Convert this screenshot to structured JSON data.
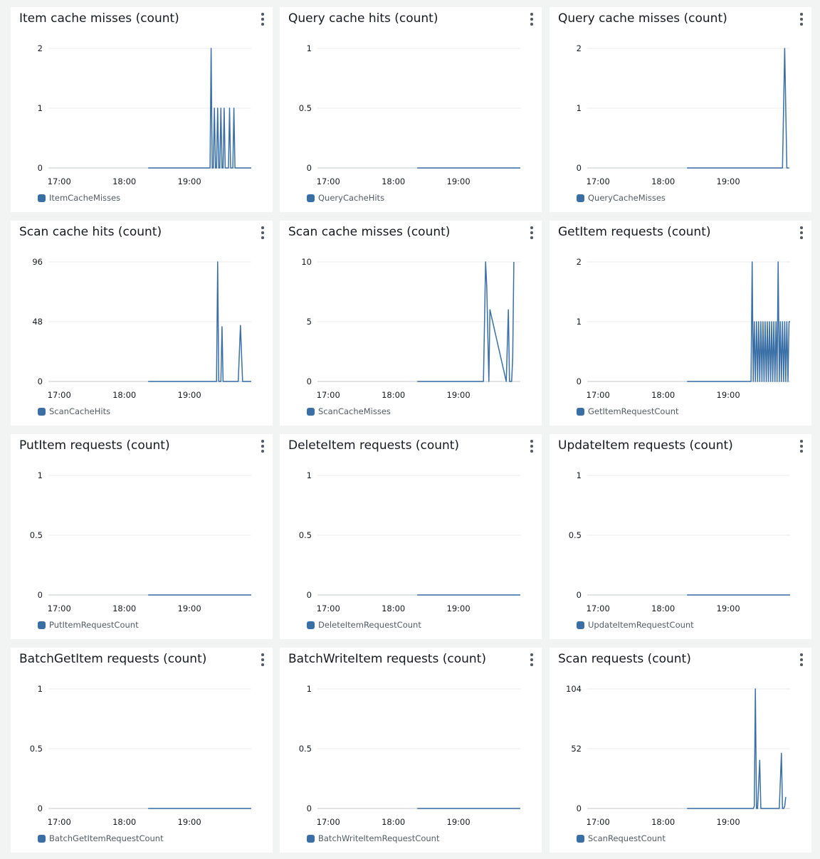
{
  "colors": {
    "series": "#3a6fa6",
    "grid": "#eaeded",
    "axis": "#d5dbdb"
  },
  "x_ticks": [
    "17:00",
    "18:00",
    "19:00"
  ],
  "chart_data": [
    {
      "type": "line",
      "title": "Item cache misses (count)",
      "legend": "ItemCacheMisses",
      "yticks": [
        "0",
        "1",
        "2"
      ],
      "ylim": [
        0,
        2
      ],
      "xlim": [
        "16:50",
        "19:57"
      ],
      "data_start": "18:22",
      "series": [
        {
          "name": "ItemCacheMisses",
          "x": [
            "18:22",
            "19:19",
            "19:20",
            "19:21",
            "19:22",
            "19:23",
            "19:24",
            "19:25",
            "19:26",
            "19:27",
            "19:28",
            "19:29",
            "19:30",
            "19:31",
            "19:32",
            "19:33",
            "19:34",
            "19:35",
            "19:36",
            "19:37",
            "19:38",
            "19:39",
            "19:40",
            "19:41",
            "19:42",
            "19:43",
            "19:57"
          ],
          "y": [
            0,
            0,
            2,
            0,
            0,
            1,
            0,
            0,
            1,
            0,
            0,
            1,
            0,
            0,
            1,
            0,
            0,
            0,
            0,
            1,
            0,
            0,
            0,
            1,
            0,
            0,
            0
          ]
        }
      ]
    },
    {
      "type": "line",
      "title": "Query cache hits (count)",
      "legend": "QueryCacheHits",
      "yticks": [
        "0",
        "0.5",
        "1"
      ],
      "ylim": [
        0,
        1
      ],
      "xlim": [
        "16:50",
        "19:57"
      ],
      "data_start": "18:22",
      "series": [
        {
          "name": "QueryCacheHits",
          "x": [
            "18:22",
            "19:57"
          ],
          "y": [
            0,
            0
          ]
        }
      ]
    },
    {
      "type": "line",
      "title": "Query cache misses (count)",
      "legend": "QueryCacheMisses",
      "yticks": [
        "0",
        "1",
        "2"
      ],
      "ylim": [
        0,
        2
      ],
      "xlim": [
        "16:50",
        "19:57"
      ],
      "data_start": "18:22",
      "series": [
        {
          "name": "QueryCacheMisses",
          "x": [
            "18:22",
            "19:50",
            "19:52",
            "19:54",
            "19:56"
          ],
          "y": [
            0,
            0,
            2,
            0,
            0
          ]
        }
      ]
    },
    {
      "type": "line",
      "title": "Scan cache hits (count)",
      "legend": "ScanCacheHits",
      "yticks": [
        "0",
        "48",
        "96"
      ],
      "ylim": [
        0,
        96
      ],
      "xlim": [
        "16:50",
        "19:57"
      ],
      "data_start": "18:22",
      "series": [
        {
          "name": "ScanCacheHits",
          "x": [
            "18:22",
            "19:24",
            "19:25",
            "19:26",
            "19:27",
            "19:29",
            "19:30",
            "19:31",
            "19:45",
            "19:47",
            "19:49",
            "19:57"
          ],
          "y": [
            0,
            0,
            0,
            96,
            0,
            0,
            44,
            0,
            0,
            45,
            0,
            0
          ]
        }
      ]
    },
    {
      "type": "line",
      "title": "Scan cache misses (count)",
      "legend": "ScanCacheMisses",
      "yticks": [
        "0",
        "5",
        "10"
      ],
      "ylim": [
        0,
        10
      ],
      "xlim": [
        "16:50",
        "19:57"
      ],
      "data_start": "18:22",
      "series": [
        {
          "name": "ScanCacheMisses",
          "x": [
            "18:22",
            "19:23",
            "19:25",
            "19:26",
            "19:28",
            "19:29",
            "19:44",
            "19:46",
            "19:47",
            "19:49",
            "19:50",
            "19:51"
          ],
          "y": [
            0,
            0,
            10,
            8,
            0,
            6,
            0,
            6,
            0,
            0,
            2,
            10
          ]
        }
      ]
    },
    {
      "type": "line",
      "title": "GetItem requests (count)",
      "legend": "GetItemRequestCount",
      "yticks": [
        "0",
        "1",
        "2"
      ],
      "ylim": [
        0,
        2
      ],
      "xlim": [
        "16:50",
        "19:57"
      ],
      "data_start": "18:22",
      "series": [
        {
          "name": "GetItemRequestCount",
          "x": [
            "18:22",
            "19:21",
            "19:22",
            "19:23",
            "19:24",
            "19:25",
            "19:26",
            "19:27",
            "19:28",
            "19:29",
            "19:30",
            "19:31",
            "19:32",
            "19:33",
            "19:34",
            "19:35",
            "19:36",
            "19:37",
            "19:38",
            "19:39",
            "19:40",
            "19:41",
            "19:42",
            "19:43",
            "19:44",
            "19:45",
            "19:46",
            "19:47",
            "19:48",
            "19:49",
            "19:50",
            "19:51",
            "19:52",
            "19:53",
            "19:54",
            "19:55",
            "19:56",
            "19:57"
          ],
          "y": [
            0,
            0,
            2,
            0,
            1,
            0,
            1,
            0,
            1,
            0,
            1,
            0,
            1,
            0,
            1,
            0,
            1,
            0,
            1,
            0,
            1,
            0,
            1,
            0,
            1,
            0,
            2,
            0,
            1,
            0,
            1,
            0,
            1,
            0,
            1,
            0,
            1,
            1
          ]
        }
      ]
    },
    {
      "type": "line",
      "title": "PutItem requests (count)",
      "legend": "PutItemRequestCount",
      "yticks": [
        "0",
        "0.5",
        "1"
      ],
      "ylim": [
        0,
        1
      ],
      "xlim": [
        "16:50",
        "19:57"
      ],
      "data_start": "18:22",
      "series": [
        {
          "name": "PutItemRequestCount",
          "x": [
            "18:22",
            "19:57"
          ],
          "y": [
            0,
            0
          ]
        }
      ]
    },
    {
      "type": "line",
      "title": "DeleteItem requests (count)",
      "legend": "DeleteItemRequestCount",
      "yticks": [
        "0",
        "0.5",
        "1"
      ],
      "ylim": [
        0,
        1
      ],
      "xlim": [
        "16:50",
        "19:57"
      ],
      "data_start": "18:22",
      "series": [
        {
          "name": "DeleteItemRequestCount",
          "x": [
            "18:22",
            "19:57"
          ],
          "y": [
            0,
            0
          ]
        }
      ]
    },
    {
      "type": "line",
      "title": "UpdateItem requests (count)",
      "legend": "UpdateItemRequestCount",
      "yticks": [
        "0",
        "0.5",
        "1"
      ],
      "ylim": [
        0,
        1
      ],
      "xlim": [
        "16:50",
        "19:57"
      ],
      "data_start": "18:22",
      "series": [
        {
          "name": "UpdateItemRequestCount",
          "x": [
            "18:22",
            "19:57"
          ],
          "y": [
            0,
            0
          ]
        }
      ]
    },
    {
      "type": "line",
      "title": "BatchGetItem requests (count)",
      "legend": "BatchGetItemRequestCount",
      "yticks": [
        "0",
        "0.5",
        "1"
      ],
      "ylim": [
        0,
        1
      ],
      "xlim": [
        "16:50",
        "19:57"
      ],
      "data_start": "18:22",
      "series": [
        {
          "name": "BatchGetItemRequestCount",
          "x": [
            "18:22",
            "19:57"
          ],
          "y": [
            0,
            0
          ]
        }
      ]
    },
    {
      "type": "line",
      "title": "BatchWriteItem requests (count)",
      "legend": "BatchWriteItemRequestCount",
      "yticks": [
        "0",
        "0.5",
        "1"
      ],
      "ylim": [
        0,
        1
      ],
      "xlim": [
        "16:50",
        "19:57"
      ],
      "data_start": "18:22",
      "series": [
        {
          "name": "BatchWriteItemRequestCount",
          "x": [
            "18:22",
            "19:57"
          ],
          "y": [
            0,
            0
          ]
        }
      ]
    },
    {
      "type": "line",
      "title": "Scan requests (count)",
      "legend": "ScanRequestCount",
      "yticks": [
        "0",
        "52",
        "104"
      ],
      "ylim": [
        0,
        104
      ],
      "xlim": [
        "16:50",
        "19:57"
      ],
      "data_start": "18:22",
      "series": [
        {
          "name": "ScanRequestCount",
          "x": [
            "18:22",
            "19:23",
            "19:24",
            "19:25",
            "19:26",
            "19:27",
            "19:29",
            "19:30",
            "19:47",
            "19:49",
            "19:50",
            "19:51",
            "19:52",
            "19:53"
          ],
          "y": [
            0,
            0,
            2,
            104,
            0,
            0,
            42,
            0,
            0,
            48,
            0,
            0,
            2,
            10
          ]
        }
      ]
    }
  ]
}
